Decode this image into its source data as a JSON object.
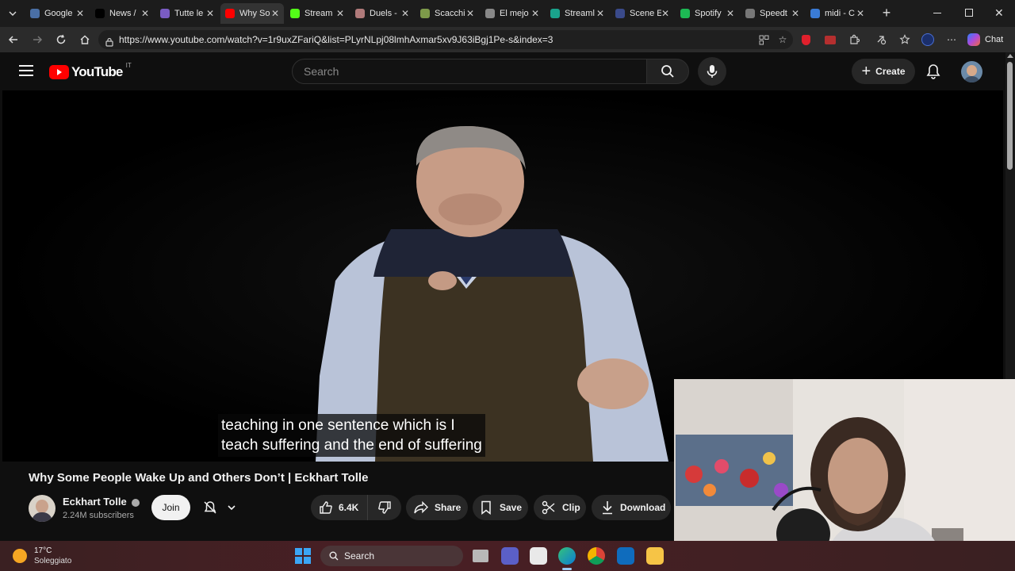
{
  "browser": {
    "tabs": [
      {
        "label": "Google",
        "color": "#4a6fa5",
        "active": false
      },
      {
        "label": "News /",
        "color": "#000000",
        "active": false
      },
      {
        "label": "Tutte le",
        "color": "#7a5cc2",
        "active": false
      },
      {
        "label": "Why So",
        "color": "#ff0000",
        "active": true
      },
      {
        "label": "Stream",
        "color": "#53fc18",
        "active": false
      },
      {
        "label": "Duels -",
        "color": "#b07a7a",
        "active": false
      },
      {
        "label": "Scacchi",
        "color": "#7d9a4a",
        "active": false
      },
      {
        "label": "El mejo",
        "color": "#888888",
        "active": false
      },
      {
        "label": "Streaml",
        "color": "#1aa38c",
        "active": false
      },
      {
        "label": "Scene E",
        "color": "#3a4a8a",
        "active": false
      },
      {
        "label": "Spotify",
        "color": "#1db954",
        "active": false
      },
      {
        "label": "Speedt",
        "color": "#777777",
        "active": false
      },
      {
        "label": "midi - C",
        "color": "#3a7bd5",
        "active": false
      }
    ],
    "new_tab": "+",
    "url": "https://www.youtube.com/watch?v=1r9uxZFariQ&list=PLyrNLpj08lmhAxmar5xv9J63iBgj1Pe-s&index=3",
    "chat_label": "Chat"
  },
  "youtube": {
    "logo_text": "YouTube",
    "logo_region": "IT",
    "search_placeholder": "Search",
    "create_label": "Create",
    "caption_line1": "teaching in one sentence which is I",
    "caption_line2": "teach suffering and the end of suffering",
    "video_title": "Why Some People Wake Up and Others Don’t | Eckhart Tolle",
    "channel_name": "Eckhart Tolle",
    "subscribers": "2.24M subscribers",
    "join_label": "Join",
    "likes": "6.4K",
    "share_label": "Share",
    "save_label": "Save",
    "clip_label": "Clip",
    "download_label": "Download"
  },
  "taskbar": {
    "temperature": "17°C",
    "weather": "Soleggiato",
    "search_label": "Search"
  }
}
